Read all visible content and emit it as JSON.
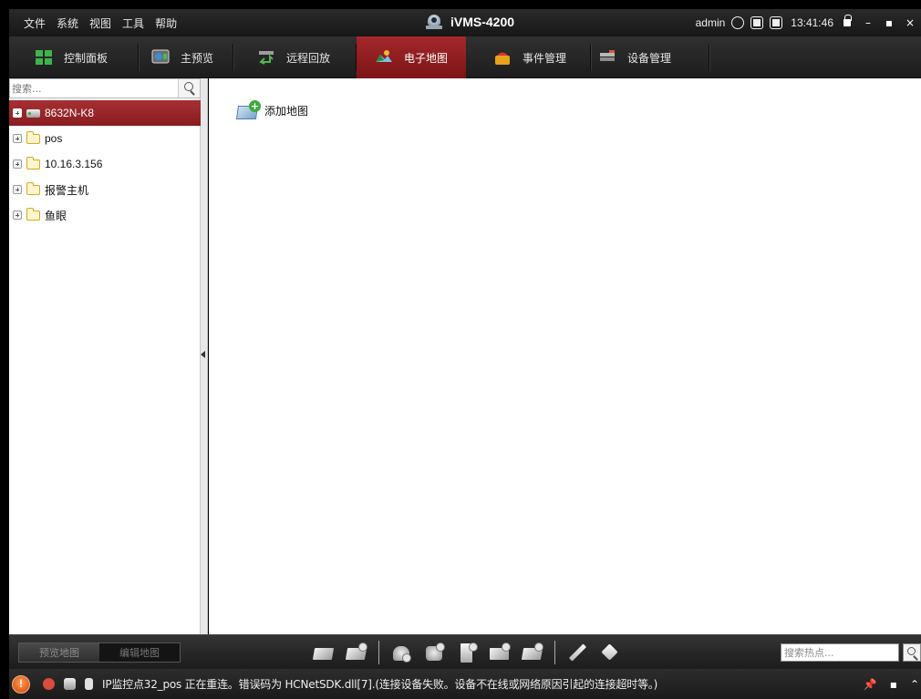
{
  "app": {
    "title": "iVMS-4200",
    "user": "admin",
    "time": "13:41:46"
  },
  "menu": [
    "文件",
    "系统",
    "视图",
    "工具",
    "帮助"
  ],
  "tabs": [
    {
      "label": "控制面板",
      "icon": "dashboard-icon"
    },
    {
      "label": "主预览",
      "icon": "preview-icon"
    },
    {
      "label": "远程回放",
      "icon": "playback-icon"
    },
    {
      "label": "电子地图",
      "icon": "emap-icon",
      "active": true
    },
    {
      "label": "事件管理",
      "icon": "event-icon"
    },
    {
      "label": "设备管理",
      "icon": "device-manage-icon"
    }
  ],
  "sidebar": {
    "search_placeholder": "搜索...",
    "tree": [
      {
        "label": "8632N-K8",
        "type": "device",
        "selected": true
      },
      {
        "label": "pos",
        "type": "folder"
      },
      {
        "label": "10.16.3.156",
        "type": "folder"
      },
      {
        "label": "报警主机",
        "type": "folder"
      },
      {
        "label": "鱼眼",
        "type": "folder"
      }
    ]
  },
  "main": {
    "add_map_label": "添加地图"
  },
  "bottombar": {
    "preview_map_label": "预览地图",
    "edit_map_label": "编辑地图",
    "hotspot_search_placeholder": "搜索热点..."
  },
  "statusbar": {
    "message": "IP监控点32_pos 正在重连。错误码为 HCNetSDK.dll[7].(连接设备失败。设备不在线或网络原因引起的连接超时等。)"
  },
  "colors": {
    "accent_red": "#8f1c1f",
    "toolbar_dark": "#1d1d1d",
    "folder_yellow": "#d8a820"
  }
}
